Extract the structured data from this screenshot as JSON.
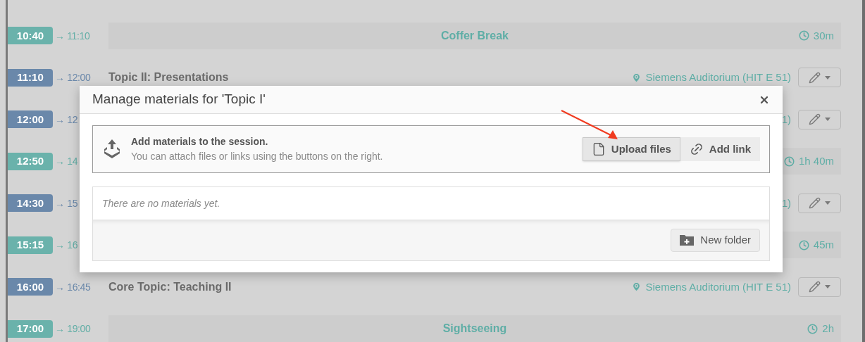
{
  "timetable": {
    "entries": [
      {
        "kind": "break",
        "start": "10:40",
        "end": "→ 11:10",
        "title": "Coffer Break",
        "duration": "30m"
      },
      {
        "kind": "contribution",
        "start": "11:10",
        "end": "→ 12:00",
        "title": "Topic II: Presentations",
        "pin": true,
        "location": "Siemens Auditorium (HIT E 51)"
      },
      {
        "kind": "contribution",
        "start": "12:00",
        "end": "→ 12",
        "location": "1)"
      },
      {
        "kind": "break",
        "start": "12:50",
        "end": "→ 14",
        "duration": "1h 40m"
      },
      {
        "kind": "contribution",
        "start": "14:30",
        "end": "→ 15",
        "location": "1)"
      },
      {
        "kind": "break",
        "start": "15:15",
        "end": "→ 16",
        "duration": "45m"
      },
      {
        "kind": "contribution",
        "start": "16:00",
        "end": "→ 16:45",
        "title": "Core Topic: Teaching II",
        "pin": true,
        "location": "Siemens Auditorium (HIT E 51)"
      },
      {
        "kind": "break",
        "start": "17:00",
        "end": "→ 19:00",
        "title": "Sightseeing",
        "duration": "2h"
      }
    ]
  },
  "dialog": {
    "title": "Manage materials for 'Topic I'",
    "info": {
      "heading": "Add materials to the session.",
      "text": "You can attach files or links using the buttons on the right."
    },
    "actions": [
      {
        "kind": "file",
        "label": "Upload files",
        "pressed": true
      },
      {
        "kind": "link",
        "label": "Add link",
        "pressed": false
      }
    ],
    "empty_text": "There are no materials yet.",
    "footer_button": "New folder"
  }
}
